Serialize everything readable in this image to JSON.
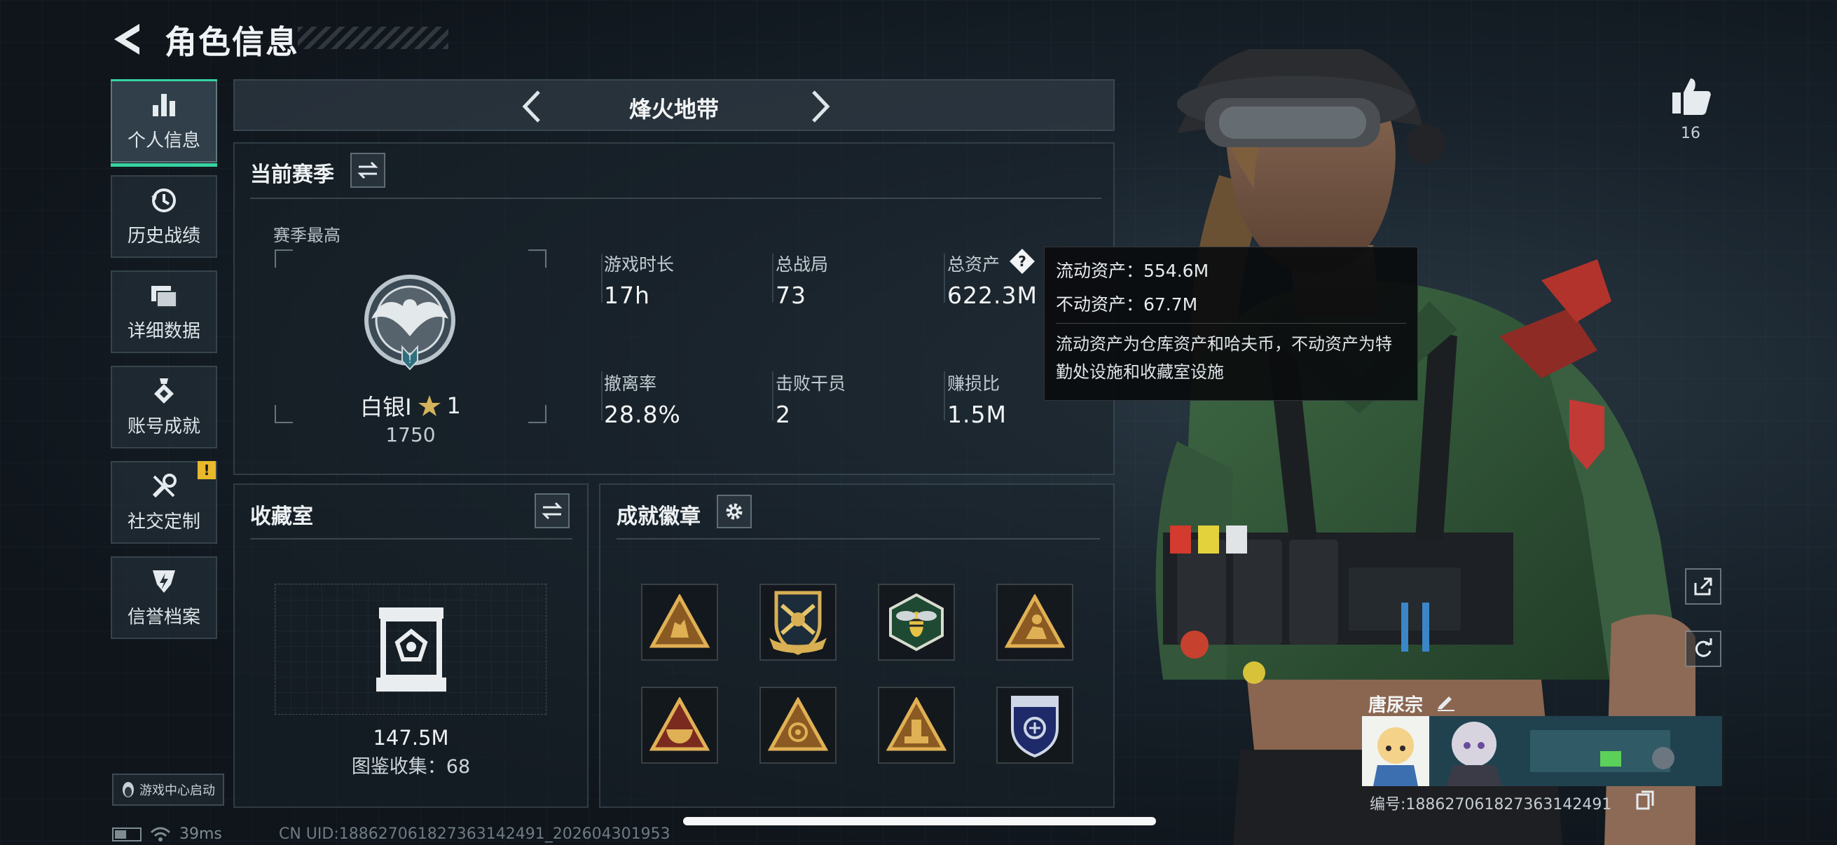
{
  "header": {
    "title": "角色信息"
  },
  "nav": {
    "items": [
      {
        "label": "个人信息",
        "icon": "bar-chart-icon",
        "active": true
      },
      {
        "label": "历史战绩",
        "icon": "history-icon"
      },
      {
        "label": "详细数据",
        "icon": "folder-icon"
      },
      {
        "label": "账号成就",
        "icon": "medal-icon"
      },
      {
        "label": "社交定制",
        "icon": "tools-icon",
        "badge": "!"
      },
      {
        "label": "信誉档案",
        "icon": "credit-shield-icon"
      }
    ],
    "game_center_label": "游戏中心启动"
  },
  "mode": {
    "title": "烽火地带"
  },
  "season": {
    "title": "当前赛季",
    "season_high_label": "赛季最高",
    "rank_name": "白银I",
    "rank_stars": "1",
    "rank_score": "1750",
    "stats": [
      {
        "label": "游戏时长",
        "value": "17h"
      },
      {
        "label": "总战局",
        "value": "73"
      },
      {
        "label": "总资产",
        "value": "622.3M"
      },
      {
        "label": "撤离率",
        "value": "28.8%"
      },
      {
        "label": "击败干员",
        "value": "2"
      },
      {
        "label": "赚损比",
        "value": "1.5M"
      }
    ]
  },
  "tooltip": {
    "liquid": "流动资产：554.6M",
    "fixed": "不动资产：67.7M",
    "note": "流动资产为仓库资产和哈夫币，不动资产为特勤处设施和收藏室设施"
  },
  "collection": {
    "title": "收藏室",
    "value": "147.5M",
    "count": "图鉴收集：68"
  },
  "achievements": {
    "title": "成就徽章",
    "badges": [
      "triangle-soldiers-badge-icon",
      "crossed-rifles-shield-badge-icon",
      "wasp-hexagon-badge-icon",
      "triangle-figure-badge-icon",
      "triangle-bowl-badge-icon",
      "triangle-flower-badge-icon",
      "triangle-tower-badge-icon",
      "police-shield-badge-icon"
    ]
  },
  "right": {
    "like_count": "16",
    "player_name": "唐尿宗",
    "player_uid": "编号:188627061827363142491"
  },
  "footer": {
    "ping": "39ms",
    "uid": "CN UID:188627061827363142491_202604301953"
  },
  "colors": {
    "accent": "#37d3a2",
    "badge_gold": "#d6a53a",
    "warning": "#e8b92b",
    "panel_border": "#5f717a"
  }
}
